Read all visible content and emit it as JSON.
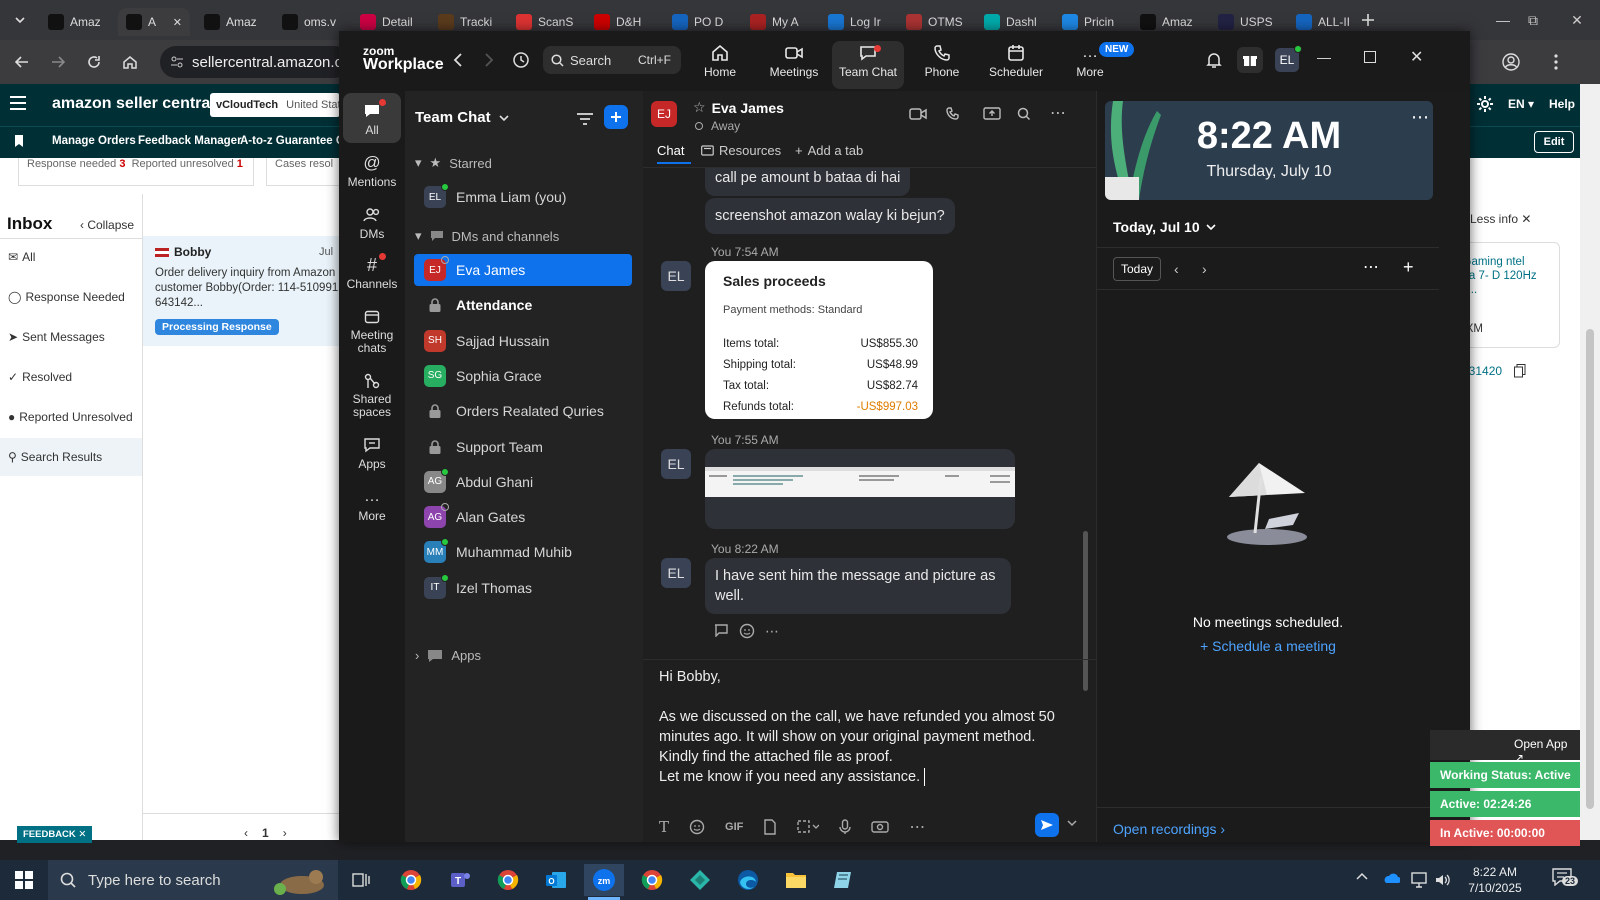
{
  "browser": {
    "tabs": [
      {
        "label": "Amaz",
        "icon": "amazon-icon",
        "color": "#111"
      },
      {
        "label": "A",
        "icon": "amazon-icon",
        "color": "#111"
      },
      {
        "label": "Amaz",
        "icon": "amazon-icon",
        "color": "#111"
      },
      {
        "label": "oms.v",
        "icon": "oms-icon",
        "color": "#111"
      },
      {
        "label": "Detail",
        "icon": "detail-icon",
        "color": "#c04"
      },
      {
        "label": "Tracki",
        "icon": "ups-icon",
        "color": "#5a3b1c"
      },
      {
        "label": "ScanS",
        "icon": "scan-icon",
        "color": "#d33"
      },
      {
        "label": "D&H",
        "icon": "dh-icon",
        "color": "#c00"
      },
      {
        "label": "PO D",
        "icon": "ec-icon",
        "color": "#1565c0"
      },
      {
        "label": "My A",
        "icon": "my-icon",
        "color": "#a22"
      },
      {
        "label": "Log Ir",
        "icon": "login-icon",
        "color": "#1976d2"
      },
      {
        "label": "OTMS",
        "icon": "otms-icon",
        "color": "#a33"
      },
      {
        "label": "Dashl",
        "icon": "dash-icon",
        "color": "#0aa"
      },
      {
        "label": "Pricin",
        "icon": "pricing-icon",
        "color": "#1e88e5"
      },
      {
        "label": "Amaz",
        "icon": "amazon-icon",
        "color": "#111"
      },
      {
        "label": "USPS",
        "icon": "usps-icon",
        "color": "#224"
      },
      {
        "label": "ALL-II",
        "icon": "all-icon",
        "color": "#1565c0"
      }
    ],
    "url": "sellercentral.amazon.com"
  },
  "amazon": {
    "logo": "amazon seller central",
    "store": "vCloudTech",
    "region": "United Stat",
    "language": "EN",
    "help": "Help",
    "edit": "Edit",
    "nav": [
      "Manage Orders",
      "Feedback Manager",
      "A-to-z Guarantee Cla"
    ],
    "chips": [
      "Response needed",
      "3",
      "Reported unresolved",
      "1",
      "Cases resol"
    ],
    "inbox_title": "Inbox",
    "collapse": "Collapse",
    "left_nav": [
      "All",
      "Response Needed",
      "Sent Messages",
      "Resolved",
      "Reported Unresolved",
      "Search Results"
    ],
    "message": {
      "sender": "Bobby",
      "date": "Jul",
      "preview": "Order delivery inquiry from Amazon customer Bobby(Order: 114-510991 643142...",
      "badge": "Processing Response"
    },
    "pagination": "1",
    "less_info": "Less info",
    "product_snippet": "C Gaming ntel Ultra 7- D 120Hz Dis...",
    "asin_snippet": "6NXM",
    "order_snippet": "431420",
    "feedback": "FEEDBACK"
  },
  "zoom": {
    "brand_top": "zoom",
    "brand_bottom": "Workplace",
    "search_placeholder": "Search",
    "search_shortcut": "Ctrl+F",
    "nav": [
      {
        "label": "Home",
        "icon": "home-icon"
      },
      {
        "label": "Meetings",
        "icon": "video-icon"
      },
      {
        "label": "Team Chat",
        "icon": "chat-icon"
      },
      {
        "label": "Phone",
        "icon": "phone-icon"
      },
      {
        "label": "Scheduler",
        "icon": "calendar-icon"
      },
      {
        "label": "More",
        "icon": "more-icon"
      }
    ],
    "new_badge": "NEW",
    "user_initials": "EL",
    "rail": [
      {
        "label": "All",
        "icon": "chat-bubble-icon"
      },
      {
        "label": "Mentions",
        "icon": "at-icon"
      },
      {
        "label": "DMs",
        "icon": "people-icon"
      },
      {
        "label": "Channels",
        "icon": "hash-icon"
      },
      {
        "label": "Meeting chats",
        "icon": "meeting-chat-icon"
      },
      {
        "label": "Shared spaces",
        "icon": "shared-icon"
      },
      {
        "label": "Apps",
        "icon": "apps-icon"
      },
      {
        "label": "More",
        "icon": "ellipsis-icon"
      }
    ],
    "list_title": "Team Chat",
    "starred_label": "Starred",
    "dms_label": "DMs and channels",
    "apps_label": "Apps",
    "starred": [
      {
        "initials": "EL",
        "name": "Emma Liam (you)",
        "color": "#3a4356",
        "status": "online"
      }
    ],
    "contacts": [
      {
        "initials": "EJ",
        "name": "Eva James",
        "color": "#c62828",
        "status": "away",
        "selected": true
      },
      {
        "initials": "",
        "name": "Attendance",
        "color": "#444",
        "status": "lock",
        "bold": true
      },
      {
        "initials": "SH",
        "name": "Sajjad Hussain",
        "color": "#c0392b",
        "status": "none"
      },
      {
        "initials": "SG",
        "name": "Sophia Grace",
        "color": "#27ae60",
        "status": "none"
      },
      {
        "initials": "",
        "name": "Orders Realated Quries",
        "color": "#444",
        "status": "lock"
      },
      {
        "initials": "",
        "name": "Support Team",
        "color": "#444",
        "status": "lock"
      },
      {
        "initials": "AG",
        "name": "Abdul Ghani",
        "color": "#888",
        "status": "online"
      },
      {
        "initials": "AG",
        "name": "Alan Gates",
        "color": "#8e44ad",
        "status": "away"
      },
      {
        "initials": "MM",
        "name": "Muhammad Muhib",
        "color": "#2980b9",
        "status": "online"
      },
      {
        "initials": "IT",
        "name": "Izel Thomas",
        "color": "#3a4356",
        "status": "online"
      }
    ],
    "chat": {
      "contact_initials": "EJ",
      "contact_name": "Eva James",
      "contact_status": "Away",
      "tabs": [
        "Chat",
        "Resources",
        "Add a tab"
      ],
      "messages": [
        {
          "text": "call pe amount b bataa di hai"
        },
        {
          "text": "screenshot amazon walay ki bejun?"
        }
      ],
      "time1": "You 7:54 AM",
      "time2": "You 7:55 AM",
      "time3": "You 8:22 AM",
      "sender_initials": "EL",
      "card": {
        "title": "Sales proceeds",
        "subtitle": "Payment methods: Standard",
        "rows": [
          {
            "label": "Items total:",
            "value": "US$855.30"
          },
          {
            "label": "Shipping total:",
            "value": "US$48.99"
          },
          {
            "label": "Tax total:",
            "value": "US$82.74"
          },
          {
            "label": "Refunds total:",
            "value": "-US$997.03"
          }
        ]
      },
      "last_message": "I have sent him the message and picture as well.",
      "compose_lines": [
        "Hi Bobby,",
        "",
        "As we discussed on the call, we have refunded you almost 50",
        "minutes ago. It will show on your original payment method.",
        "Kindly find the attached file as proof.",
        "Let me know if you need any assistance."
      ],
      "gif": "GIF"
    },
    "calendar": {
      "time": "8:22 AM",
      "date": "Thursday, July 10",
      "today_label": "Today, Jul 10",
      "today_btn": "Today",
      "empty": "No meetings scheduled.",
      "schedule": "Schedule a meeting",
      "recordings": "Open recordings"
    }
  },
  "widget": {
    "open_app": "Open App",
    "working_status": "Working Status: Active",
    "active": "Active: 02:24:26",
    "inactive": "In Active: 00:00:00"
  },
  "taskbar": {
    "search_placeholder": "Type here to search",
    "time": "8:22 AM",
    "date": "7/10/2025",
    "notifications": "23"
  },
  "colors": {
    "zoom_blue": "#0e72ed",
    "amazon_teal": "#002f36",
    "refund_orange": "#e07b00",
    "status_green": "#3bb86a",
    "status_red": "#e05555"
  }
}
